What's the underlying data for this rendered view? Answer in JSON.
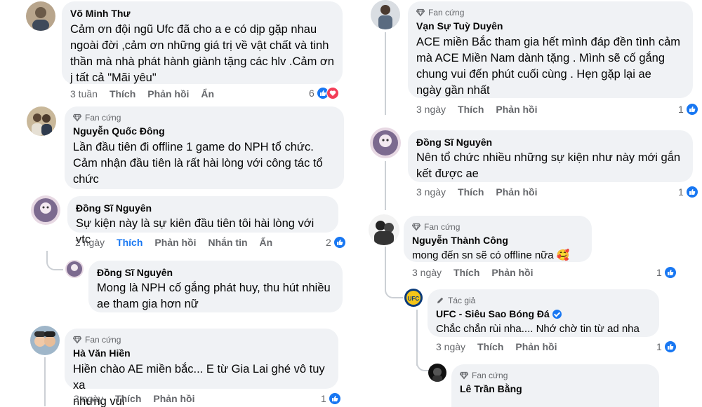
{
  "left_column": {
    "comments": [
      {
        "author": "Võ Minh Thư",
        "badge": "",
        "lines": [
          "Cảm ơn đội ngũ Ufc đã cho a e có dịp gặp nhau",
          "ngoài đời ,cảm ơn những giá trị về  vật chất và tinh",
          "thần mà nhà phát hành giành tặng các hlv .Cảm ơn",
          "j tất cả \"Mãi yêu\""
        ],
        "time": "3 tuần",
        "like_label": "Thích",
        "reply_label": "Phản hồi",
        "hide_label": "Ẩn",
        "reaction_count": "6",
        "reactions": [
          "like-icon",
          "love-icon"
        ]
      },
      {
        "author": "Nguyễn Quốc Đông",
        "badge": "Fan cứng",
        "lines": [
          "Lần đầu tiên đi offline 1 game do NPH tổ chức.",
          "Cảm nhận đầu tiên là rất hài lòng với công tác tổ",
          "chức"
        ]
      },
      {
        "author": "Đồng Sĩ Nguyên",
        "badge": "",
        "lines": [
          "Sự kiện này là sự kiên đầu tiên tôi hài lòng với vtc"
        ],
        "time": "2 ngày",
        "like_label": "Thích",
        "reply_label": "Phản hồi",
        "message_label": "Nhắn tin",
        "hide_label": "Ẩn",
        "reaction_count": "2"
      },
      {
        "author": "Đồng Sĩ Nguyên",
        "badge": "",
        "lines": [
          "Mong là NPH cố gắng phát huy, thu hút nhiều",
          "ae tham gia hơn nữ"
        ]
      },
      {
        "author": "Hà Văn Hiền",
        "badge": "Fan cứng",
        "lines": [
          "Hiền chào AE miền bắc... E từ Gia Lai ghé vô tuy xa",
          "nhưng vui"
        ],
        "time": "3 ngày",
        "like_label": "Thích",
        "reply_label": "Phản hồi",
        "reaction_count": "1"
      }
    ]
  },
  "right_column": {
    "comments": [
      {
        "author": "Vạn Sự Tuỳ Duyên",
        "badge": "Fan cứng",
        "lines": [
          "ACE miền Bắc tham gia hết mình đáp đền tình cảm",
          "mà ACE  Miền Nam dành tặng . Mình sẽ cố gắng",
          "chung vui đến phút cuối cùng . Hẹn gặp lại ae",
          "ngày gần nhất"
        ],
        "time": "3 ngày",
        "like_label": "Thích",
        "reply_label": "Phản hồi",
        "reaction_count": "1"
      },
      {
        "author": "Đồng Sĩ Nguyên",
        "badge": "",
        "lines": [
          "Nên tổ chức nhiều những sự kiện như này mới gắn",
          "kết được ae"
        ],
        "time": "3 ngày",
        "like_label": "Thích",
        "reply_label": "Phản hồi",
        "reaction_count": "1"
      },
      {
        "author": "Nguyễn Thành Công",
        "badge": "Fan cứng",
        "lines": [
          "mong đến sn sẽ có offline nữa 🥰"
        ],
        "time": "3 ngày",
        "like_label": "Thích",
        "reply_label": "Phản hồi",
        "reaction_count": "1"
      },
      {
        "author": "UFC - Siêu Sao Bóng Đá",
        "badge": "Tác giả",
        "lines": [
          "Chắc chắn rùi nha.... Nhớ chờ tin từ ad nha"
        ],
        "time": "3 ngày",
        "like_label": "Thích",
        "reply_label": "Phản hồi",
        "reaction_count": "1"
      },
      {
        "author": "Lê Trần Bằng",
        "badge": "Fan cứng",
        "lines": []
      }
    ]
  },
  "colors": {
    "bubble": "#f0f2f5",
    "meta_text": "#65676b",
    "accent_blue": "#1877f2",
    "love_red": "#f33e58",
    "thread_line": "#ccd0d5"
  }
}
